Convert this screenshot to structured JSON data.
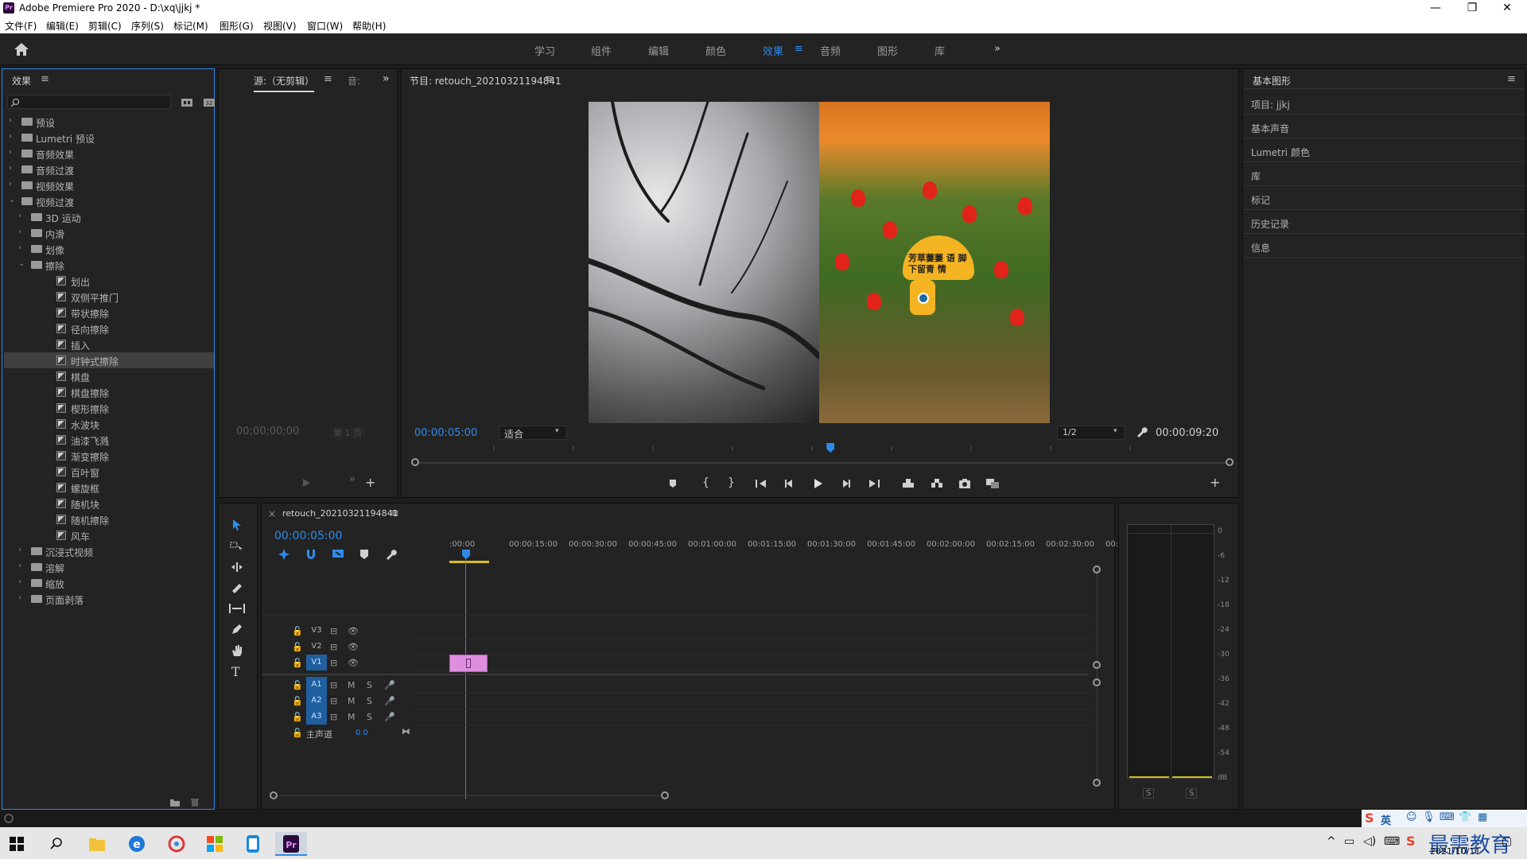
{
  "window": {
    "title": "Adobe Premiere Pro 2020 - D:\\xq\\jjkj *",
    "app_badge": "Pr",
    "min": "—",
    "max": "❐",
    "close": "✕"
  },
  "menu": [
    "文件(F)",
    "编辑(E)",
    "剪辑(C)",
    "序列(S)",
    "标记(M)",
    "图形(G)",
    "视图(V)",
    "窗口(W)",
    "帮助(H)"
  ],
  "workspaces": {
    "items": [
      "学习",
      "组件",
      "编辑",
      "颜色",
      "效果",
      "音频",
      "图形",
      "库"
    ],
    "active": "效果",
    "more": "»",
    "active_menu": "≡"
  },
  "effects_panel": {
    "title": "效果",
    "menu": "≡",
    "search_placeholder": "",
    "tree": [
      {
        "label": "预设",
        "level": 0,
        "kind": "folder",
        "expanded": false
      },
      {
        "label": "Lumetri 预设",
        "level": 0,
        "kind": "folder",
        "expanded": false
      },
      {
        "label": "音频效果",
        "level": 0,
        "kind": "folder",
        "expanded": false
      },
      {
        "label": "音频过渡",
        "level": 0,
        "kind": "folder",
        "expanded": false
      },
      {
        "label": "视频效果",
        "level": 0,
        "kind": "folder",
        "expanded": false
      },
      {
        "label": "视频过渡",
        "level": 0,
        "kind": "folder",
        "expanded": true
      },
      {
        "label": "3D 运动",
        "level": 1,
        "kind": "folder",
        "expanded": false
      },
      {
        "label": "内滑",
        "level": 1,
        "kind": "folder",
        "expanded": false
      },
      {
        "label": "划像",
        "level": 1,
        "kind": "folder",
        "expanded": false
      },
      {
        "label": "擦除",
        "level": 1,
        "kind": "folder",
        "expanded": true
      },
      {
        "label": "划出",
        "level": 2,
        "kind": "fx"
      },
      {
        "label": "双侧平推门",
        "level": 2,
        "kind": "fx"
      },
      {
        "label": "带状擦除",
        "level": 2,
        "kind": "fx"
      },
      {
        "label": "径向擦除",
        "level": 2,
        "kind": "fx"
      },
      {
        "label": "插入",
        "level": 2,
        "kind": "fx"
      },
      {
        "label": "时钟式擦除",
        "level": 2,
        "kind": "fx",
        "selected": true
      },
      {
        "label": "棋盘",
        "level": 2,
        "kind": "fx"
      },
      {
        "label": "棋盘擦除",
        "level": 2,
        "kind": "fx"
      },
      {
        "label": "楔形擦除",
        "level": 2,
        "kind": "fx"
      },
      {
        "label": "水波块",
        "level": 2,
        "kind": "fx"
      },
      {
        "label": "油漆飞溅",
        "level": 2,
        "kind": "fx"
      },
      {
        "label": "渐变擦除",
        "level": 2,
        "kind": "fx"
      },
      {
        "label": "百叶窗",
        "level": 2,
        "kind": "fx"
      },
      {
        "label": "螺旋框",
        "level": 2,
        "kind": "fx"
      },
      {
        "label": "随机块",
        "level": 2,
        "kind": "fx"
      },
      {
        "label": "随机擦除",
        "level": 2,
        "kind": "fx"
      },
      {
        "label": "风车",
        "level": 2,
        "kind": "fx"
      },
      {
        "label": "沉浸式视频",
        "level": 1,
        "kind": "folder",
        "expanded": false
      },
      {
        "label": "溶解",
        "level": 1,
        "kind": "folder",
        "expanded": false
      },
      {
        "label": "缩放",
        "level": 1,
        "kind": "folder",
        "expanded": false
      },
      {
        "label": "页面剥落",
        "level": 1,
        "kind": "folder",
        "expanded": false
      }
    ]
  },
  "source_panel": {
    "tab_label": "源:（无剪辑）",
    "menu": "≡",
    "second_tab": "音:",
    "more": "»",
    "timecode": "00;00;00;00",
    "page": "第 1 页",
    "add": "+"
  },
  "program_panel": {
    "title": "节目: retouch_20210321194841",
    "menu": "≡",
    "current_timecode": "00:00:05:00",
    "fit": "适合",
    "resolution": "1/2",
    "duration": "00:00:09:20",
    "playhead_fraction": 0.51,
    "sign_text": "芳草萋萋 语 脚下留青 情",
    "add": "+"
  },
  "essential_panel": {
    "title": "基本图形",
    "menu": "≡",
    "items": [
      "项目: jjkj",
      "基本声音",
      "Lumetri 颜色",
      "库",
      "标记",
      "历史记录",
      "信息"
    ]
  },
  "timeline": {
    "close": "×",
    "title": "retouch_20210321194841",
    "menu": "≡",
    "timecode": "00:00:05:00",
    "ruler": [
      ":00:00",
      "00:00:15:00",
      "00:00:30:00",
      "00:00:45:00",
      "00:01:00:00",
      "00:01:15:00",
      "00:01:30:00",
      "00:01:45:00",
      "00:02:00:00",
      "00:02:15:00",
      "00:02:30:00",
      "00:"
    ],
    "video_tracks": [
      "V3",
      "V2",
      "V1"
    ],
    "audio_tracks": [
      "A1",
      "A2",
      "A3"
    ],
    "master_label": "主声道",
    "master_value": "0.0",
    "mute": "M",
    "solo": "S"
  },
  "audio_meter": {
    "ticks": [
      "0",
      "-6",
      "-12",
      "-18",
      "-24",
      "-30",
      "-36",
      "-42",
      "-48",
      "-54",
      "dB"
    ],
    "solo_left": "S",
    "solo_right": "S"
  },
  "taskbar": {
    "ime_lang": "英",
    "date": "2021/10/11",
    "watermark": "最需教育"
  },
  "colors": {
    "accent": "#2d8ceb",
    "panel": "#232323",
    "clip": "#e08ee0",
    "track_on": "#1f5fa0"
  }
}
